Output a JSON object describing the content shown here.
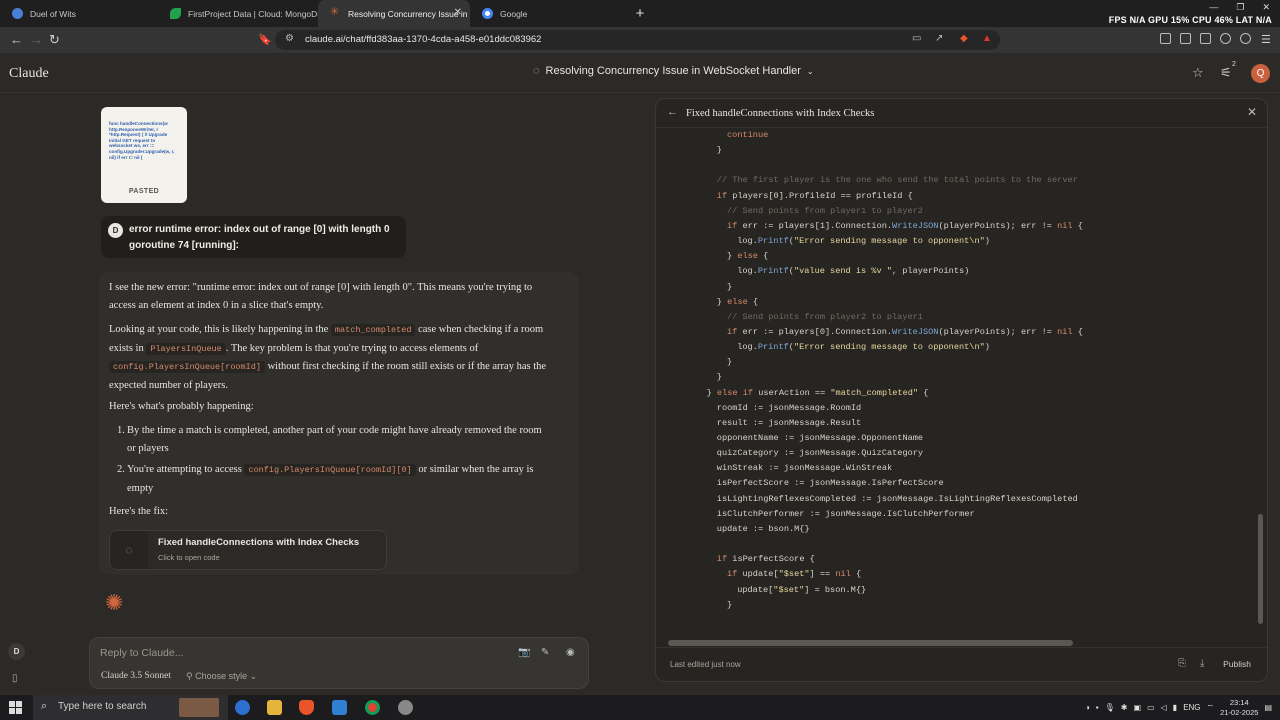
{
  "browser": {
    "tabs": [
      {
        "label": "Duel of Wits",
        "color": "#4a7fd6",
        "active": false
      },
      {
        "label": "FirstProject Data | Cloud: MongoDB",
        "color": "#21a150",
        "active": false
      },
      {
        "label": "Resolving Concurrency Issue in",
        "color": "#d0663e",
        "active": true
      },
      {
        "label": "Google",
        "color": "#4285f4",
        "active": false
      }
    ],
    "new_tab": "+",
    "perf": "FPS N/A GPU 15% CPU 46% LAT N/A",
    "url": "claude.ai/chat/ffd383aa-1370-4cda-a458-e01ddc083962"
  },
  "app": {
    "logo": "Claude",
    "conversation_title": "Resolving Concurrency Issue in WebSocket Handler",
    "notif_count": "2",
    "user_initial": "Q"
  },
  "chat": {
    "pasted": {
      "snippet": "func handleConnections(w http.ResponseWriter, r *http.Request) { // Upgrade initial GET request to websocket ws, err := config.Upgrader.Upgrade(w, r, nil) if err != nil {",
      "badge": "PASTED"
    },
    "user_message": {
      "initial": "D",
      "text": "error runtime error: index out of range [0] with length 0 goroutine 74 [running]:"
    },
    "assistant": {
      "p1": "I see the new error: \"runtime error: index out of range [0] with length 0\". This means you're trying to access an element at index 0 in a slice that's empty.",
      "p2_a": "Looking at your code, this is likely happening in the",
      "p2_code1": "match_completed",
      "p2_b": "case when checking if a room exists in",
      "p2_code2": "PlayersInQueue",
      "p2_c": ". The key problem is that you're trying to access elements of",
      "p2_code3": "config.PlayersInQueue[roomId]",
      "p2_d": "without first checking if the room still exists or if the array has the expected number of players.",
      "p3": "Here's what's probably happening:",
      "li1": "By the time a match is completed, another part of your code might have already removed the room or players",
      "li2_a": "You're attempting to access",
      "li2_code": "config.PlayersInQueue[roomId][0]",
      "li2_b": "or similar when the array is empty",
      "p4": "Here's the fix:",
      "artifact_title": "Fixed handleConnections with Index Checks",
      "artifact_sub": "Click to open code"
    },
    "composer": {
      "placeholder": "Reply to Claude...",
      "model": "Claude 3.5 Sonnet",
      "style": "Choose style"
    },
    "sidebar_initial": "D"
  },
  "panel": {
    "title": "Fixed handleConnections with Index Checks",
    "footer_status": "Last edited just now",
    "publish": "Publish",
    "code_lines": [
      {
        "indent": 5,
        "html": "<span class='k'>continue</span>"
      },
      {
        "indent": 4,
        "html": "}"
      },
      {
        "indent": 0,
        "html": ""
      },
      {
        "indent": 4,
        "html": "<span class='c'>// The first player is the one who send the total points to the server</span>"
      },
      {
        "indent": 4,
        "html": "<span class='k'>if</span> players[0].ProfileId == profileId {"
      },
      {
        "indent": 5,
        "html": "<span class='c'>// Send points from player1 to player2</span>"
      },
      {
        "indent": 5,
        "html": "<span class='k'>if</span> err := players[1].Connection.<span class='f'>WriteJSON</span>(playerPoints); err != <span class='k'>nil</span> {"
      },
      {
        "indent": 6,
        "html": "log.<span class='f'>Printf</span>(<span class='s'>\"Error sending message to opponent\\n\"</span>)"
      },
      {
        "indent": 5,
        "html": "} <span class='k'>else</span> {"
      },
      {
        "indent": 6,
        "html": "log.<span class='f'>Printf</span>(<span class='s'>\"value send is %v \"</span>, playerPoints)"
      },
      {
        "indent": 5,
        "html": "}"
      },
      {
        "indent": 4,
        "html": "} <span class='k'>else</span> {"
      },
      {
        "indent": 5,
        "html": "<span class='c'>// Send points from player2 to player1</span>"
      },
      {
        "indent": 5,
        "html": "<span class='k'>if</span> err := players[0].Connection.<span class='f'>WriteJSON</span>(playerPoints); err != <span class='k'>nil</span> {"
      },
      {
        "indent": 6,
        "html": "log.<span class='f'>Printf</span>(<span class='s'>\"Error sending message to opponent\\n\"</span>)"
      },
      {
        "indent": 5,
        "html": "}"
      },
      {
        "indent": 4,
        "html": "}"
      },
      {
        "indent": 3,
        "html": "} <span class='k'>else if</span> userAction == <span class='s'>\"match_completed\"</span> {"
      },
      {
        "indent": 4,
        "html": "roomId := jsonMessage.RoomId"
      },
      {
        "indent": 4,
        "html": "result := jsonMessage.Result"
      },
      {
        "indent": 4,
        "html": "opponentName := jsonMessage.OpponentName"
      },
      {
        "indent": 4,
        "html": "quizCategory := jsonMessage.QuizCategory"
      },
      {
        "indent": 4,
        "html": "winStreak := jsonMessage.WinStreak"
      },
      {
        "indent": 4,
        "html": "isPerfectScore := jsonMessage.IsPerfectScore"
      },
      {
        "indent": 4,
        "html": "isLightingReflexesCompleted := jsonMessage.IsLightingReflexesCompleted"
      },
      {
        "indent": 4,
        "html": "isClutchPerformer := jsonMessage.IsClutchPerformer"
      },
      {
        "indent": 4,
        "html": "update := bson.M{}"
      },
      {
        "indent": 0,
        "html": ""
      },
      {
        "indent": 4,
        "html": "<span class='k'>if</span> isPerfectScore {"
      },
      {
        "indent": 5,
        "html": "<span class='k'>if</span> update[<span class='s'>\"$set\"</span>] == <span class='k'>nil</span> {"
      },
      {
        "indent": 6,
        "html": "update[<span class='s'>\"$set\"</span>] = bson.M{}"
      },
      {
        "indent": 5,
        "html": "}"
      }
    ]
  },
  "taskbar": {
    "search_placeholder": "Type here to search",
    "language": "ENG",
    "time": "23:14",
    "date": "21-02-2025"
  }
}
